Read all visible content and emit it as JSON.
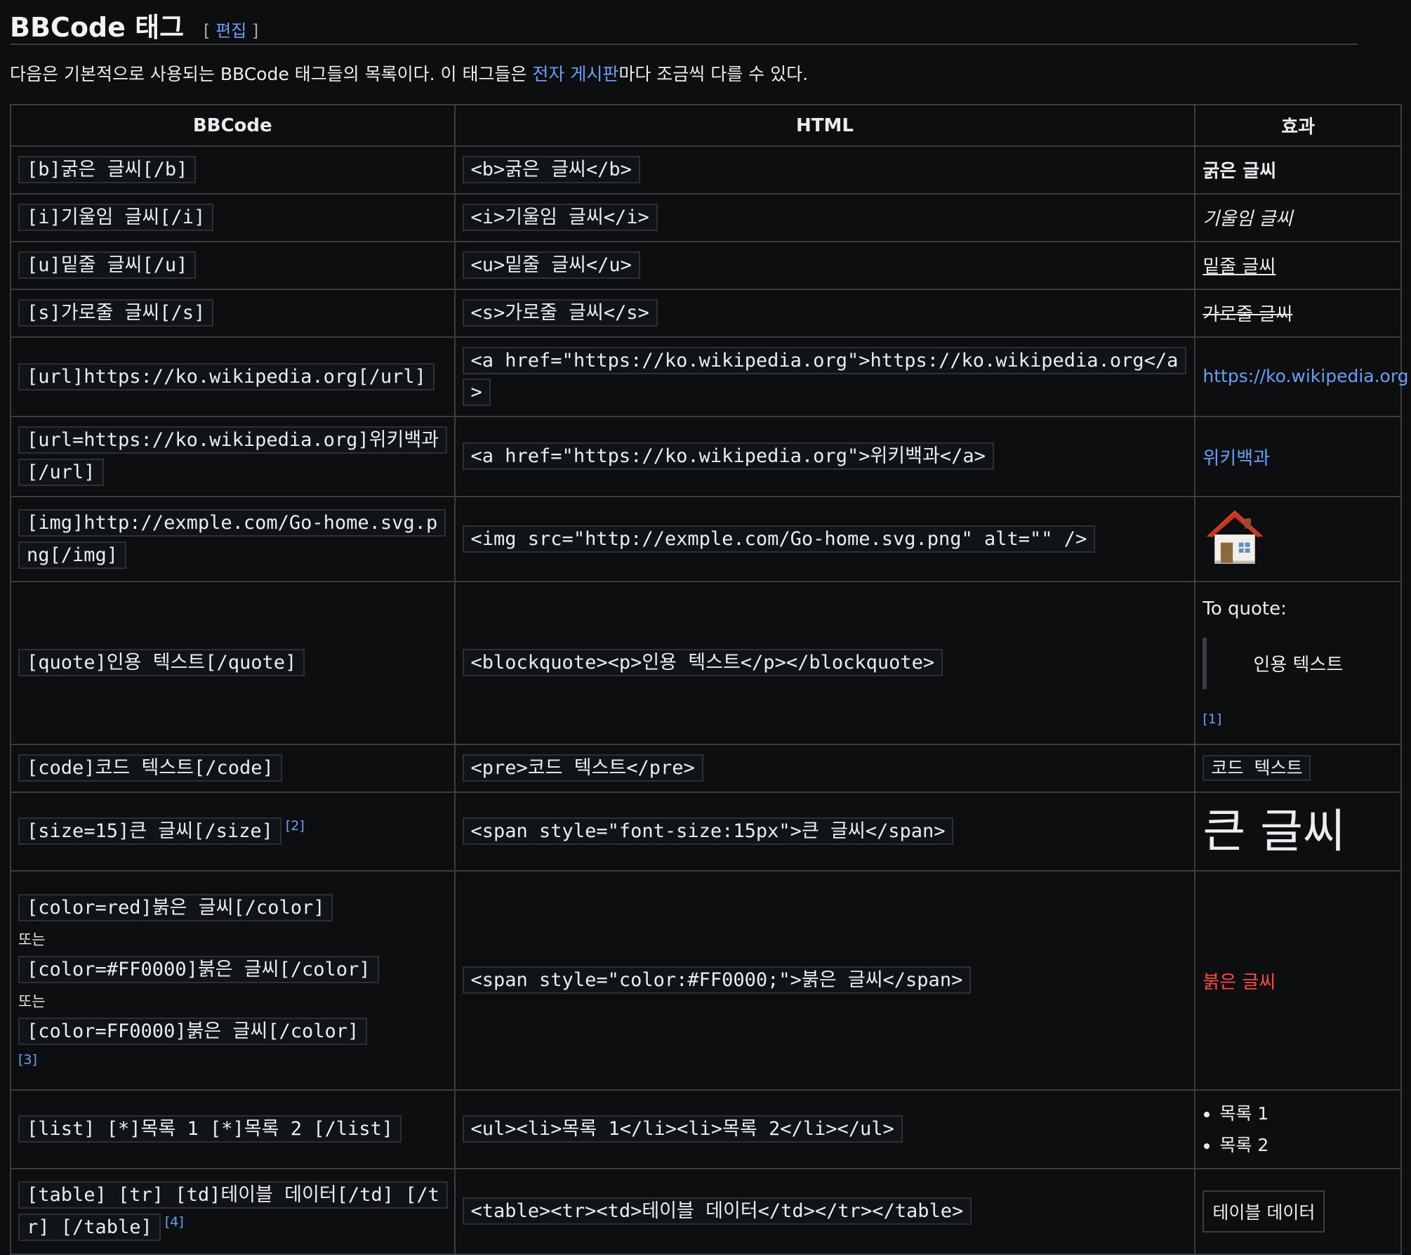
{
  "heading": {
    "title": "BBCode 태그",
    "edit_open": "[",
    "edit_link": "편집",
    "edit_close": "]"
  },
  "intro": {
    "before": "다음은 기본적으로 사용되는 BBCode 태그들의 목록이다. 이 태그들은 ",
    "link": "전자 게시판",
    "after": "마다 조금씩 다를 수 있다."
  },
  "table": {
    "headers": [
      "BBCode",
      "HTML",
      "효과"
    ],
    "rows": [
      {
        "bbcode": "[b]굵은 글씨[/b]",
        "html": "<b>굵은 글씨</b>",
        "effect": "굵은 글씨"
      },
      {
        "bbcode": "[i]기울임 글씨[/i]",
        "html": "<i>기울임 글씨</i>",
        "effect": "기울임 글씨"
      },
      {
        "bbcode": "[u]밑줄 글씨[/u]",
        "html": "<u>밑줄 글씨</u>",
        "effect": "밑줄 글씨"
      },
      {
        "bbcode": "[s]가로줄 글씨[/s]",
        "html": "<s>가로줄 글씨</s>",
        "effect": "가로줄 글씨"
      },
      {
        "bbcode": "[url]https://ko.wikipedia.org[/url]",
        "html": "<a href=\"https://ko.wikipedia.org\">https://ko.wikipedia.org</a>",
        "effect": "https://ko.wikipedia.org"
      },
      {
        "bbcode": "[url=https://ko.wikipedia.org]위키백과[/url]",
        "html": "<a href=\"https://ko.wikipedia.org\">위키백과</a>",
        "effect": "위키백과"
      },
      {
        "bbcode": "[img]http://exmple.com/Go-home.svg.png[/img]",
        "html": "<img src=\"http://exmple.com/Go-home.svg.png\" alt=\"\" />",
        "effect_icon": "house-icon"
      },
      {
        "bbcode": "[quote]인용 텍스트[/quote]",
        "html": "<blockquote><p>인용 텍스트</p></blockquote>",
        "effect_intro": "To quote:",
        "effect": "인용 텍스트",
        "ref": "[1]"
      },
      {
        "bbcode": "[code]코드 텍스트[/code]",
        "html": "<pre>코드 텍스트</pre>",
        "effect": "코드 텍스트"
      },
      {
        "bbcode": "[size=15]큰 글씨[/size]",
        "ref": "[2]",
        "html": "<span style=\"font-size:15px\">큰 글씨</span>",
        "effect": "큰 글씨"
      },
      {
        "bbcode_variants": [
          "[color=red]붉은 글씨[/color]",
          "[color=#FF0000]붉은 글씨[/color]",
          "[color=FF0000]붉은 글씨[/color]"
        ],
        "or_label": "또는",
        "ref": "[3]",
        "html": "<span style=\"color:#FF0000;\">붉은 글씨</span>",
        "effect": "붉은 글씨",
        "effect_color": "#ff4a3d"
      },
      {
        "bbcode": "[list] [*]목록 1 [*]목록 2 [/list]",
        "html": "<ul><li>목록 1</li><li>목록 2</li></ul>",
        "effect_items": [
          "목록 1",
          "목록 2"
        ]
      },
      {
        "bbcode": "[table] [tr] [td]테이블 데이터[/td] [/tr] [/table]",
        "ref": "[4]",
        "html": "<table><tr><td>테이블 데이터</td></tr></table>",
        "effect": "테이블 데이터"
      }
    ]
  },
  "colors": {
    "background": "#0c0e10",
    "text": "#eaecf0",
    "link": "#6a9ff7",
    "border": "#3a3d42"
  }
}
